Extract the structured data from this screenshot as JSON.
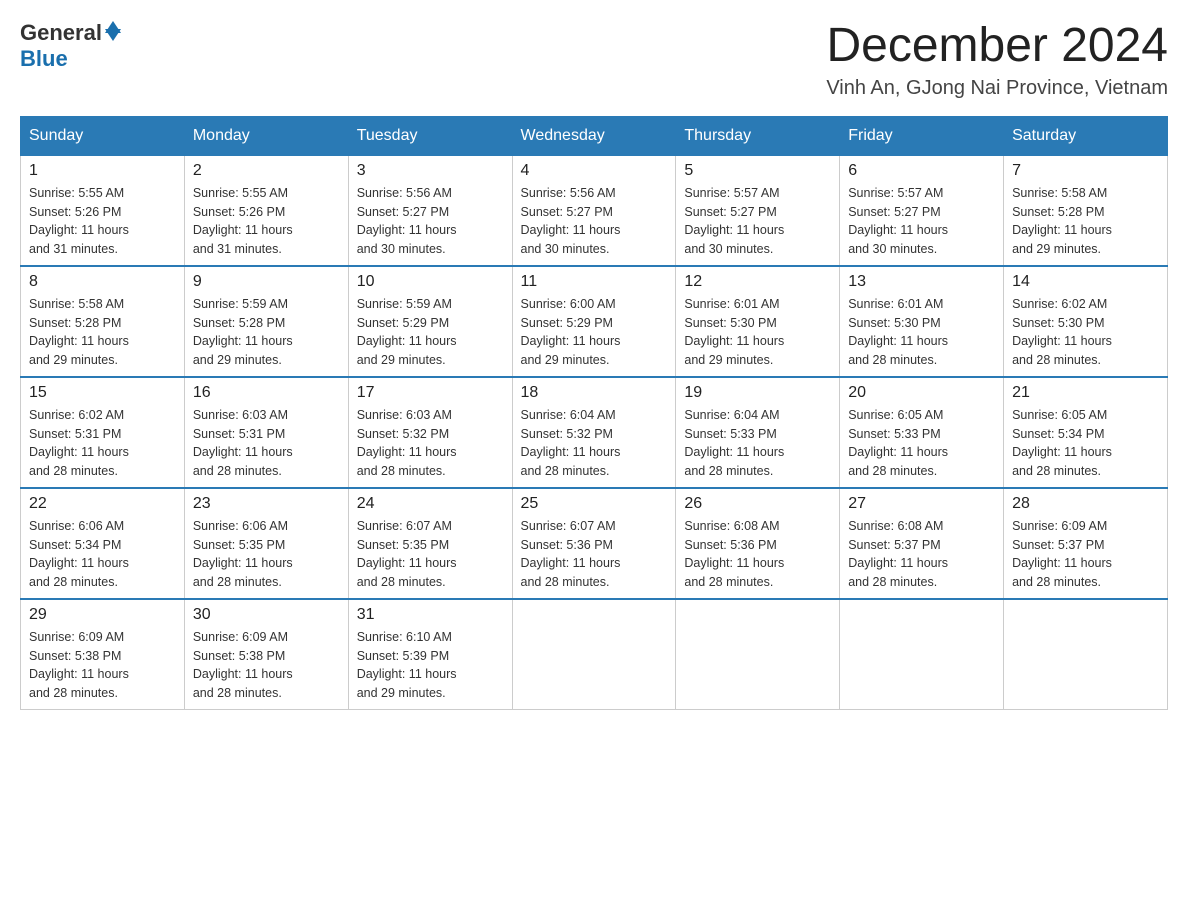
{
  "header": {
    "logo_general": "General",
    "logo_blue": "Blue",
    "month_title": "December 2024",
    "location": "Vinh An, GJong Nai Province, Vietnam"
  },
  "days_of_week": [
    "Sunday",
    "Monday",
    "Tuesday",
    "Wednesday",
    "Thursday",
    "Friday",
    "Saturday"
  ],
  "weeks": [
    [
      {
        "day": "1",
        "sunrise": "5:55 AM",
        "sunset": "5:26 PM",
        "daylight": "11 hours and 31 minutes."
      },
      {
        "day": "2",
        "sunrise": "5:55 AM",
        "sunset": "5:26 PM",
        "daylight": "11 hours and 31 minutes."
      },
      {
        "day": "3",
        "sunrise": "5:56 AM",
        "sunset": "5:27 PM",
        "daylight": "11 hours and 30 minutes."
      },
      {
        "day": "4",
        "sunrise": "5:56 AM",
        "sunset": "5:27 PM",
        "daylight": "11 hours and 30 minutes."
      },
      {
        "day": "5",
        "sunrise": "5:57 AM",
        "sunset": "5:27 PM",
        "daylight": "11 hours and 30 minutes."
      },
      {
        "day": "6",
        "sunrise": "5:57 AM",
        "sunset": "5:27 PM",
        "daylight": "11 hours and 30 minutes."
      },
      {
        "day": "7",
        "sunrise": "5:58 AM",
        "sunset": "5:28 PM",
        "daylight": "11 hours and 29 minutes."
      }
    ],
    [
      {
        "day": "8",
        "sunrise": "5:58 AM",
        "sunset": "5:28 PM",
        "daylight": "11 hours and 29 minutes."
      },
      {
        "day": "9",
        "sunrise": "5:59 AM",
        "sunset": "5:28 PM",
        "daylight": "11 hours and 29 minutes."
      },
      {
        "day": "10",
        "sunrise": "5:59 AM",
        "sunset": "5:29 PM",
        "daylight": "11 hours and 29 minutes."
      },
      {
        "day": "11",
        "sunrise": "6:00 AM",
        "sunset": "5:29 PM",
        "daylight": "11 hours and 29 minutes."
      },
      {
        "day": "12",
        "sunrise": "6:01 AM",
        "sunset": "5:30 PM",
        "daylight": "11 hours and 29 minutes."
      },
      {
        "day": "13",
        "sunrise": "6:01 AM",
        "sunset": "5:30 PM",
        "daylight": "11 hours and 28 minutes."
      },
      {
        "day": "14",
        "sunrise": "6:02 AM",
        "sunset": "5:30 PM",
        "daylight": "11 hours and 28 minutes."
      }
    ],
    [
      {
        "day": "15",
        "sunrise": "6:02 AM",
        "sunset": "5:31 PM",
        "daylight": "11 hours and 28 minutes."
      },
      {
        "day": "16",
        "sunrise": "6:03 AM",
        "sunset": "5:31 PM",
        "daylight": "11 hours and 28 minutes."
      },
      {
        "day": "17",
        "sunrise": "6:03 AM",
        "sunset": "5:32 PM",
        "daylight": "11 hours and 28 minutes."
      },
      {
        "day": "18",
        "sunrise": "6:04 AM",
        "sunset": "5:32 PM",
        "daylight": "11 hours and 28 minutes."
      },
      {
        "day": "19",
        "sunrise": "6:04 AM",
        "sunset": "5:33 PM",
        "daylight": "11 hours and 28 minutes."
      },
      {
        "day": "20",
        "sunrise": "6:05 AM",
        "sunset": "5:33 PM",
        "daylight": "11 hours and 28 minutes."
      },
      {
        "day": "21",
        "sunrise": "6:05 AM",
        "sunset": "5:34 PM",
        "daylight": "11 hours and 28 minutes."
      }
    ],
    [
      {
        "day": "22",
        "sunrise": "6:06 AM",
        "sunset": "5:34 PM",
        "daylight": "11 hours and 28 minutes."
      },
      {
        "day": "23",
        "sunrise": "6:06 AM",
        "sunset": "5:35 PM",
        "daylight": "11 hours and 28 minutes."
      },
      {
        "day": "24",
        "sunrise": "6:07 AM",
        "sunset": "5:35 PM",
        "daylight": "11 hours and 28 minutes."
      },
      {
        "day": "25",
        "sunrise": "6:07 AM",
        "sunset": "5:36 PM",
        "daylight": "11 hours and 28 minutes."
      },
      {
        "day": "26",
        "sunrise": "6:08 AM",
        "sunset": "5:36 PM",
        "daylight": "11 hours and 28 minutes."
      },
      {
        "day": "27",
        "sunrise": "6:08 AM",
        "sunset": "5:37 PM",
        "daylight": "11 hours and 28 minutes."
      },
      {
        "day": "28",
        "sunrise": "6:09 AM",
        "sunset": "5:37 PM",
        "daylight": "11 hours and 28 minutes."
      }
    ],
    [
      {
        "day": "29",
        "sunrise": "6:09 AM",
        "sunset": "5:38 PM",
        "daylight": "11 hours and 28 minutes."
      },
      {
        "day": "30",
        "sunrise": "6:09 AM",
        "sunset": "5:38 PM",
        "daylight": "11 hours and 28 minutes."
      },
      {
        "day": "31",
        "sunrise": "6:10 AM",
        "sunset": "5:39 PM",
        "daylight": "11 hours and 29 minutes."
      },
      null,
      null,
      null,
      null
    ]
  ],
  "labels": {
    "sunrise": "Sunrise:",
    "sunset": "Sunset:",
    "daylight": "Daylight:"
  }
}
